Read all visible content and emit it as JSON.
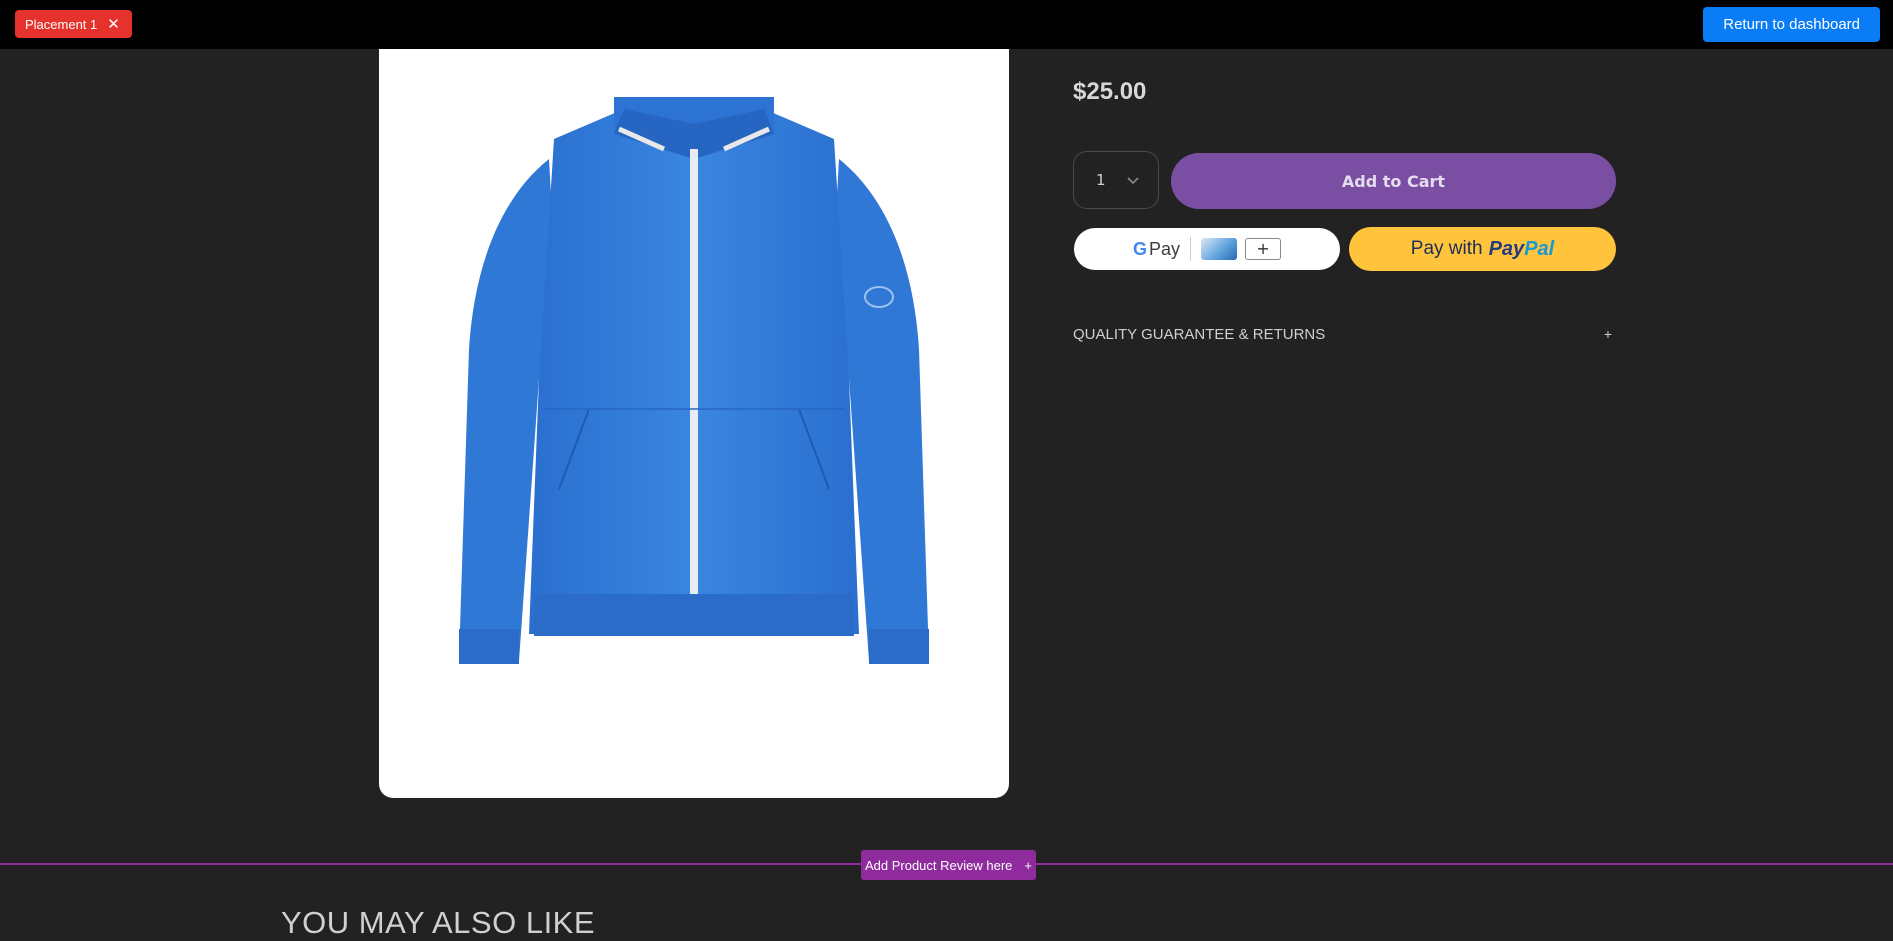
{
  "topbar": {
    "placement_label": "Placement 1",
    "placement_close_icon": "close-icon",
    "return_label": "Return to dashboard"
  },
  "product": {
    "image_alt": "Blue zip-up jacket",
    "price": "$25.00",
    "quantity": "1",
    "add_to_cart_label": "Add to Cart"
  },
  "payments": {
    "gpay_label": "Pay",
    "gpay_g": "G",
    "paypal_prefix": "Pay with",
    "paypal_brand_pay": "Pay",
    "paypal_brand_pal": "Pal"
  },
  "accordion": {
    "title": "QUALITY GUARANTEE & RETURNS",
    "toggle": "+"
  },
  "review_placeholder": {
    "label": "Add Product Review here",
    "icon": "+"
  },
  "section": {
    "also_like_title": "YOU MAY ALSO LIKE"
  },
  "colors": {
    "page_bg": "#222222",
    "add_to_cart": "#7a4fa3",
    "paypal": "#ffc33c",
    "placement_badge": "#e5322d",
    "return_button": "#0a7cf5",
    "review_accent": "#8f2b9c",
    "jacket_blue": "#2f7ad8"
  }
}
